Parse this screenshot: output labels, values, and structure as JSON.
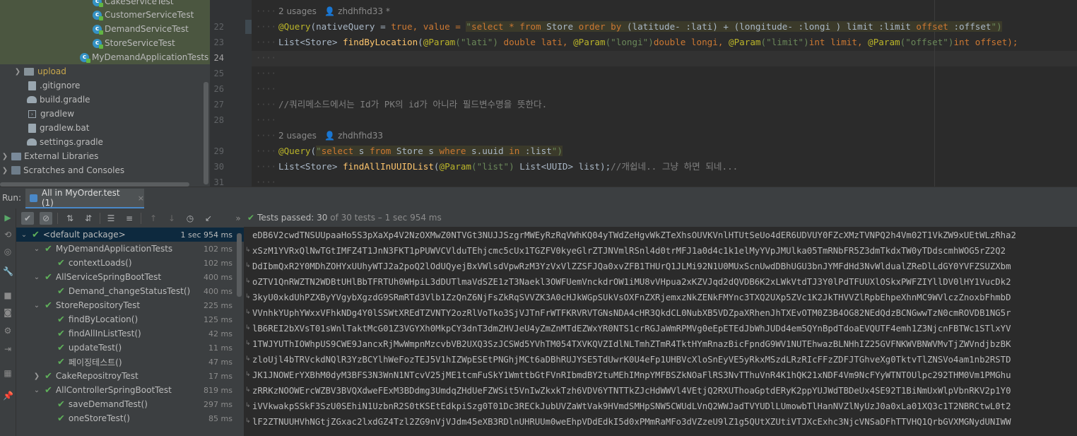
{
  "project_tree": {
    "items": [
      {
        "label": "CakeServiceTest",
        "type": "java"
      },
      {
        "label": "CustomerServiceTest",
        "type": "java"
      },
      {
        "label": "DemandServiceTest",
        "type": "java"
      },
      {
        "label": "StoreServiceTest",
        "type": "java"
      },
      {
        "label": "MyDemandApplicationTests",
        "type": "java"
      },
      {
        "label": "upload",
        "type": "folder"
      },
      {
        "label": ".gitignore",
        "type": "file"
      },
      {
        "label": "build.gradle",
        "type": "gradle"
      },
      {
        "label": "gradlew",
        "type": "terminal"
      },
      {
        "label": "gradlew.bat",
        "type": "file"
      },
      {
        "label": "settings.gradle",
        "type": "gradle"
      },
      {
        "label": "External Libraries",
        "type": "library"
      },
      {
        "label": "Scratches and Consoles",
        "type": "scratch"
      }
    ]
  },
  "editor": {
    "line_numbers": [
      "22",
      "23",
      "24",
      "25",
      "26",
      "27",
      "28",
      "29",
      "30",
      "31"
    ],
    "usage_hint_1": "2 usages",
    "author_hint_1": "zhdhfhd33 *",
    "usage_hint_2": "2 usages",
    "author_hint_2": "zhdhfhd33",
    "line22": {
      "annotation": "@Query",
      "part1": "(nativeQuery = ",
      "true": "true",
      "part2": ", value = ",
      "q_open": "\"",
      "sql_select": "select",
      "sql_star": " * ",
      "sql_from": "from",
      "sql_store": " Store ",
      "sql_order_by": "order by",
      "sql_lat": " (latitude- :lati) + (longitude- :longi ) limit :limit ",
      "sql_offset": "offset",
      "sql_offset_param": " :offset",
      "q_close": "\")"
    },
    "line23": {
      "type": "List<Store> ",
      "method": "findByLocation",
      "p1a": "(",
      "param_ann1": "@Param",
      "p1s": "(\"lati\")",
      "p1t": " double lati, ",
      "param_ann2": "@Param",
      "p2s": "(\"longi\")",
      "p2t": "double longi, ",
      "param_ann3": "@Param",
      "p3s": "(\"limit\")",
      "p3t": "int limit, ",
      "param_ann4": "@Param",
      "p4s": "(\"offset\")",
      "p4t": "int offset);"
    },
    "line27_comment": "//쿼리메소드에서는 Id가 PK의 id가 아니라 필드변수명을 뜻한다.",
    "line29": {
      "annotation": "@Query",
      "open": "(",
      "q": "\"",
      "sel": "select",
      "s1": " s ",
      "from": "from",
      "store": " Store s ",
      "where": "where",
      "uuid": " s.uuid ",
      "in": "in",
      "list": " :list",
      "close": "\")"
    },
    "line30": {
      "type": "List<Store> ",
      "method": "findAllInUUIDList",
      "open": "(",
      "param_ann": "@Param",
      "ps": "(\"list\")",
      "rest": " List<UUID> list);",
      "comment": "//개쉽네.. 그냥 하면 되네..."
    }
  },
  "run_panel": {
    "label": "Run:",
    "tab_label": "All in MyOrder.test (1)",
    "tab_close": "×",
    "status_prefix": "Tests passed: ",
    "status_count": "30",
    "status_suffix": " of 30 tests – 1 sec 954 ms",
    "tests": [
      {
        "label": "<default package>",
        "duration": "1 sec 954 ms",
        "level": 0,
        "expandable": true,
        "selected": true
      },
      {
        "label": "MyDemandApplicationTests",
        "duration": "102 ms",
        "level": 1,
        "expandable": true
      },
      {
        "label": "contextLoads()",
        "duration": "102 ms",
        "level": 2,
        "expandable": false
      },
      {
        "label": "AllServiceSpringBootTest",
        "duration": "400 ms",
        "level": 1,
        "expandable": true
      },
      {
        "label": "Demand_changeStatusTest()",
        "duration": "400 ms",
        "level": 2,
        "expandable": false
      },
      {
        "label": "StoreRepositoryTest",
        "duration": "225 ms",
        "level": 1,
        "expandable": true
      },
      {
        "label": "findByLocation()",
        "duration": "125 ms",
        "level": 2,
        "expandable": false
      },
      {
        "label": "findAllInListTest()",
        "duration": "42 ms",
        "level": 2,
        "expandable": false
      },
      {
        "label": "updateTest()",
        "duration": "11 ms",
        "level": 2,
        "expandable": false
      },
      {
        "label": "페이징테스트()",
        "duration": "47 ms",
        "level": 2,
        "expandable": false
      },
      {
        "label": "CakeRepositroyTest",
        "duration": "17 ms",
        "level": 1,
        "expandable": true
      },
      {
        "label": "AllControllerSpringBootTest",
        "duration": "819 ms",
        "level": 1,
        "expandable": true
      },
      {
        "label": "saveDemandTest()",
        "duration": "297 ms",
        "level": 2,
        "expandable": false
      },
      {
        "label": "oneStoreTest()",
        "duration": "85 ms",
        "level": 2,
        "expandable": false
      }
    ],
    "output_lines": [
      "eDB6V2cwdTNSUUpaaHo5S3pXaXp4V2NzOXMwZ0NTVGt3NUJJSzgrMWEyRzRqVWhKQ04yTWdZeHgvWkZTeXhsOUVKVnlHTUtSeUo4dER6UDVUY0FZcXMzTVNPQ2h4Vm02T1VkZW9xUEtWLzRha2",
      "xSzM1YVRxQlNwTGtIMFZ4T1JnN3FKT1pPUWVCVlduTEhjcmc5cUx1TGZFV0kyeGlrZTJNVmlRSnl4d0trMFJ1a0d4c1k1elMyYVpJMUlka05TmRNbFR5Z3dmTkdxTW0yTDdscmhWOG5rZ2Q2",
      "DdIbmQxR2Y0MDhZOHYxUUhyWTJ2a2poQ2lOdUQyejBxVWlsdVpwRzM3YzVxVlZZSFJQa0xvZFB1THUrQ1JLMi92N1U0MUxScnUwdDBhUGU3bnJYMFdHd3NvWldualZReDlLdGY0YVFZSUZXbm",
      "oZTV1QnRWZTN2WDBtUHlBbTFRTUh0WHpiL3dDUTlmaVdSZE1zT3Naekl3OWFUemVnckdrOW1iMU8vVHpua2xKZVJqd2dQVDB6K2xLWkVtdTJ3Y0lPdTFUUXlOSkxPWFZIYllDV0lHY1VucDk2",
      "3kyU0xkdUhPZXByYVgybXgzdG9SRmRTd3Vlb1ZzQnZ6NjFsZkRqSVVZK3A0cHJkWGpSUkVsOXFnZXRjemxzNkZENkFMYnc3TXQ2UXp5ZVc1K2JkTHVVZlRpbEhpeXhnMC9WVlczZnoxbFhmbD",
      "VVnhkYUphYWxxVFhkNDg4Y0lSSWtXREdTZVNTY2ozRlVoTko3SjVJTnFrWTFKRVRVTGNsNDA4cHR3QkdCL0NubXB5VDZpaXRhenJhTXEvOTM0Z3B4OG82NEdQdzBCNGwwTzN0cmROVDB1NG5r",
      "lB6REI2bXVsT01sWnlTaktMcG01Z3VGYXh0MkpCY3dnT3dmZHVJeU4yZmZnMTdEZWxYR0NTS1crRGJaWmRPMVg0eEpETEdJbWhJUDd4em5QYnBpdTdoaEVQUTF4emh1Z3NjcnFBTWc1STlxYV",
      "1TWJYUThIOWhpUS9CWE9JancxRjMwWmpnMzcvbVB2UXQ3SzJCSWd5YVhTM054TXVKQVZIdlNLTmhZTmR4TktHYmRnazBicFpndG9WV1NUTEhwazBLNHhIZ25GVFNKWVBNWVMvTjZWVndjbzBK",
      "zloUjl4bTRVckdNQlR3YzBCYlhWeFozTEJ5V1hIZWpESEtPNGhjMCt6aDBhRUJYSE5TdUwrK0U4eFp1UHBVcXloSnEyVE5yRkxMSzdLRzRIcFFzZDFJTGhveXg0TktvTlZNSVo4am1nb2RSTD",
      "JK1JNOWErYXBhM0dyM3BFS3N3WnN1NTcvV25jME1tcmFuSkY1WmttbGtFVnRIbmdBY2tuMEhIMnpYMFBSZkNOaFlRS3NvTThuVnR4K1hQK21xNDF4Vm9NcFYyWTNTOUlpc292THM0Vm1PMGhu",
      "zRRKzNOOWErcWZBV3BVQXdweFExM3BDdmg3UmdqZHdUeFZWSit5VnIwZkxkTzh6VDV6YTNTTkZJcHdWWVl4VEtjQ2RXUThoaGptdERyK2ppYUJWdTBDeUx4SE92T1BiNmUxWlpVbnRKV2p1Y0",
      "iVVkwakpSSkF3SzU0SEhiN1UzbnR2S0tKSEtEdkpiSzg0T01Dc3RECkJubUVZaWtVak9HVmdSMHpSNW5CWUdLVnQ2WWJadTVYUDlLUmowbTlHanNVZlNyUzJ0a0xLa01XQ3c1T2NBRCtwL0t2",
      "lF2ZTNUUHVhNGtjZGxac2lxdGZ4Tzl2ZG9nVjVJdm45eXB3RDlnUHRUUm0weEhpVDdEdkI5d0xPMmRaMFo3dVZzeU9lZ1g5QUtXZUtiVTJXcExhc3NjcVNSaDFhTTVHQ1QrbGVXMGNydUNIWW"
    ]
  }
}
